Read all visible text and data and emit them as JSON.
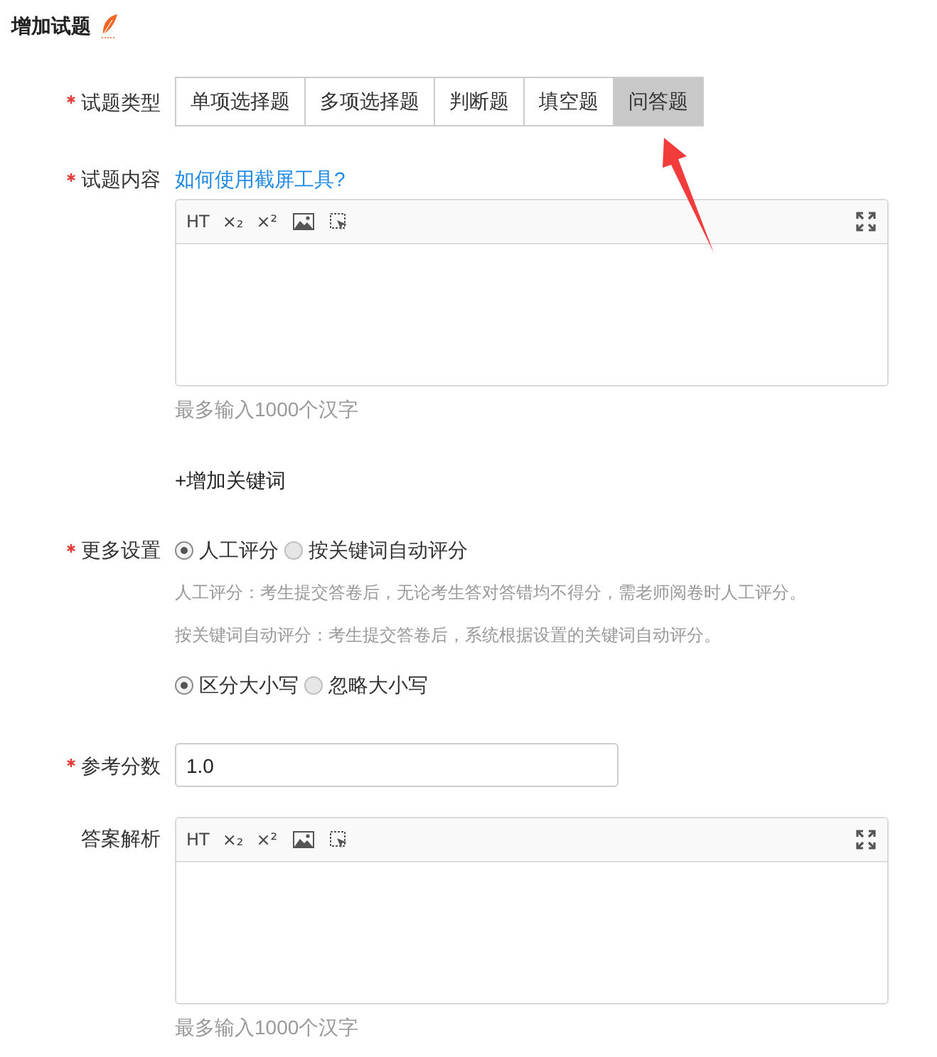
{
  "title": {
    "text": "增加试题"
  },
  "question_type": {
    "label": "试题类型",
    "required": true,
    "options": [
      {
        "label": "单项选择题",
        "selected": false
      },
      {
        "label": "多项选择题",
        "selected": false
      },
      {
        "label": "判断题",
        "selected": false
      },
      {
        "label": "填空题",
        "selected": false
      },
      {
        "label": "问答题",
        "selected": true
      }
    ]
  },
  "content": {
    "label": "试题内容",
    "required": true,
    "link": "如何使用截屏工具?",
    "toolbar": [
      {
        "kind": "text",
        "label": "HT"
      },
      {
        "kind": "text",
        "label": "×₂"
      },
      {
        "kind": "text",
        "label": "×²"
      },
      {
        "kind": "image"
      },
      {
        "kind": "select"
      },
      {
        "kind": "fullscreen"
      }
    ],
    "hint": "最多输入1000个汉字"
  },
  "add_keyword": {
    "text": "+增加关键词"
  },
  "more_settings": {
    "label": "更多设置",
    "required": true,
    "scoring": [
      {
        "label": "人工评分",
        "selected": true
      },
      {
        "label": "按关键词自动评分",
        "selected": false
      }
    ],
    "notes": [
      "人工评分：考生提交答卷后，无论考生答对答错均不得分，需老师阅卷时人工评分。",
      "按关键词自动评分：考生提交答卷后，系统根据设置的关键词自动评分。"
    ],
    "case": [
      {
        "label": "区分大小写",
        "selected": true
      },
      {
        "label": "忽略大小写",
        "selected": false
      }
    ]
  },
  "score": {
    "label": "参考分数",
    "required": true,
    "value": "1.0"
  },
  "analysis": {
    "label": "答案解析",
    "required": false,
    "toolbar": [
      {
        "kind": "text",
        "label": "HT"
      },
      {
        "kind": "text",
        "label": "×₂"
      },
      {
        "kind": "text",
        "label": "×²"
      },
      {
        "kind": "image"
      },
      {
        "kind": "select"
      },
      {
        "kind": "fullscreen"
      }
    ],
    "hint": "最多输入1000个汉字"
  }
}
